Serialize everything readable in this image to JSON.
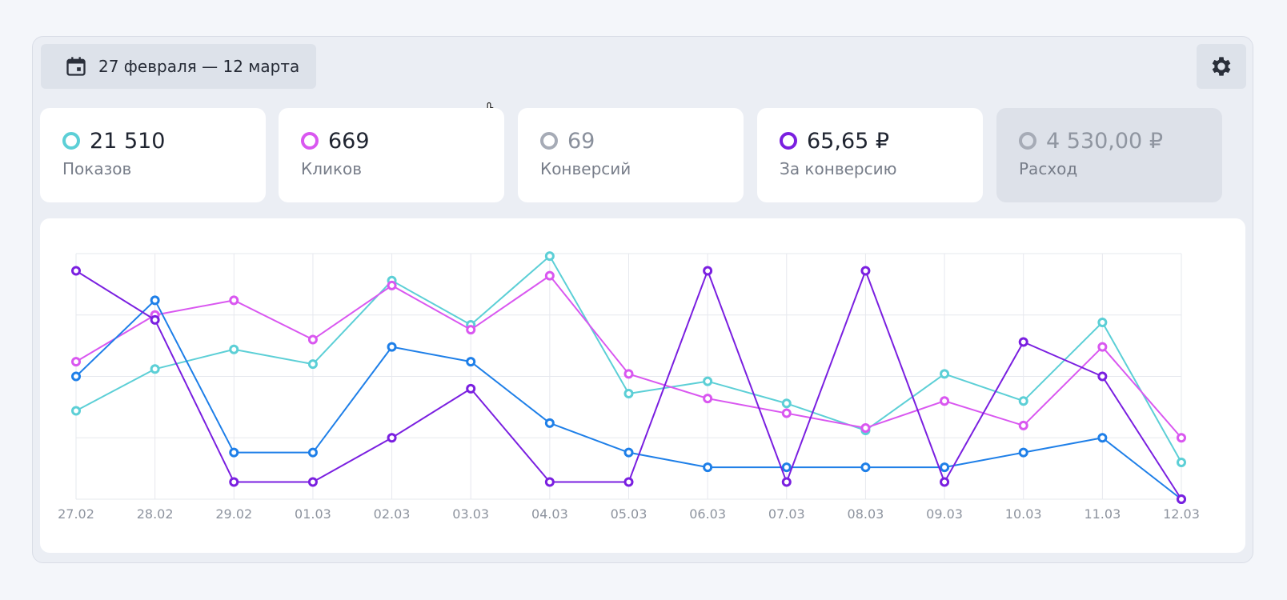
{
  "date_range": {
    "label": "27 февраля — 12 марта",
    "icon": "calendar-icon"
  },
  "settings": {
    "icon": "gear-icon"
  },
  "metrics": [
    {
      "value": "21 510",
      "label": "Показов",
      "color": "#5ccfd6"
    },
    {
      "value": "669",
      "label": "Кликов",
      "color": "#d957f0"
    },
    {
      "value": "69",
      "label": "Конверсий",
      "color": "#a6abb6"
    },
    {
      "value": "65,65 ₽",
      "label": "За конверсию",
      "color": "#7a1fe0"
    },
    {
      "value": "4 530,00 ₽",
      "label": "Расход",
      "color": "#a6abb6"
    }
  ],
  "chart_data": {
    "type": "line",
    "categories": [
      "27.02",
      "28.02",
      "29.02",
      "01.03",
      "02.03",
      "03.03",
      "04.03",
      "05.03",
      "06.03",
      "07.03",
      "08.03",
      "09.03",
      "10.03",
      "11.03",
      "12.03"
    ],
    "ylim": [
      0,
      100
    ],
    "grid": true,
    "series": [
      {
        "color": "#5ccfd6",
        "values": [
          36,
          53,
          61,
          55,
          89,
          71,
          99,
          43,
          48,
          39,
          28,
          51,
          40,
          72,
          15
        ]
      },
      {
        "color": "#d957f0",
        "values": [
          56,
          75,
          81,
          65,
          87,
          69,
          91,
          51,
          41,
          35,
          29,
          40,
          30,
          62,
          25
        ]
      },
      {
        "color": "#1e7fe8",
        "values": [
          50,
          81,
          19,
          19,
          62,
          56,
          31,
          19,
          13,
          13,
          13,
          13,
          19,
          25,
          0
        ]
      },
      {
        "color": "#7a1fe0",
        "values": [
          93,
          73,
          7,
          7,
          25,
          45,
          7,
          7,
          93,
          7,
          93,
          7,
          64,
          50,
          0
        ]
      }
    ]
  }
}
